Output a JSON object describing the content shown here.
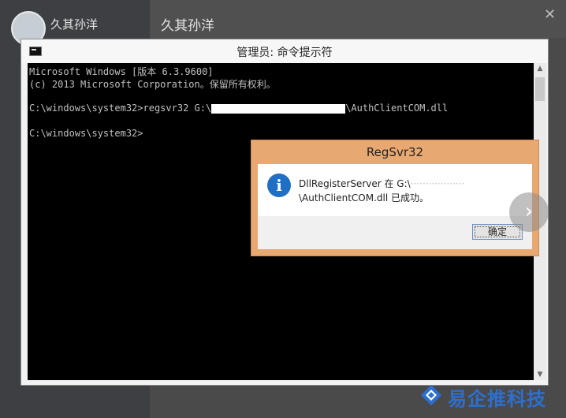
{
  "background": {
    "contact_name": "久其孙洋",
    "contact_sub": "",
    "chat_title": "久其孙洋",
    "close_glyph": "✕"
  },
  "cmd": {
    "title": "管理员: 命令提示符",
    "lines": [
      "Microsoft Windows [版本 6.3.9600]",
      "(c) 2013 Microsoft Corporation。保留所有权利。",
      "",
      "C:\\windows\\system32>regsvr32 G:\\",
      "C:\\windows\\system32>"
    ],
    "line4_suffix": "\\AuthClientCOM.dll"
  },
  "dialog": {
    "title": "RegSvr32",
    "message_prefix": "DllRegisterServer 在 G:\\",
    "message_line2": "\\AuthClientCOM.dll 已成功。",
    "ok_label": "确定"
  },
  "navigation": {
    "next_glyph": "›"
  },
  "watermark": {
    "text": "易企推科技"
  },
  "colors": {
    "dialog_frame": "#e8a872",
    "info_icon": "#1f6fc5",
    "watermark": "#2d6fd1"
  }
}
